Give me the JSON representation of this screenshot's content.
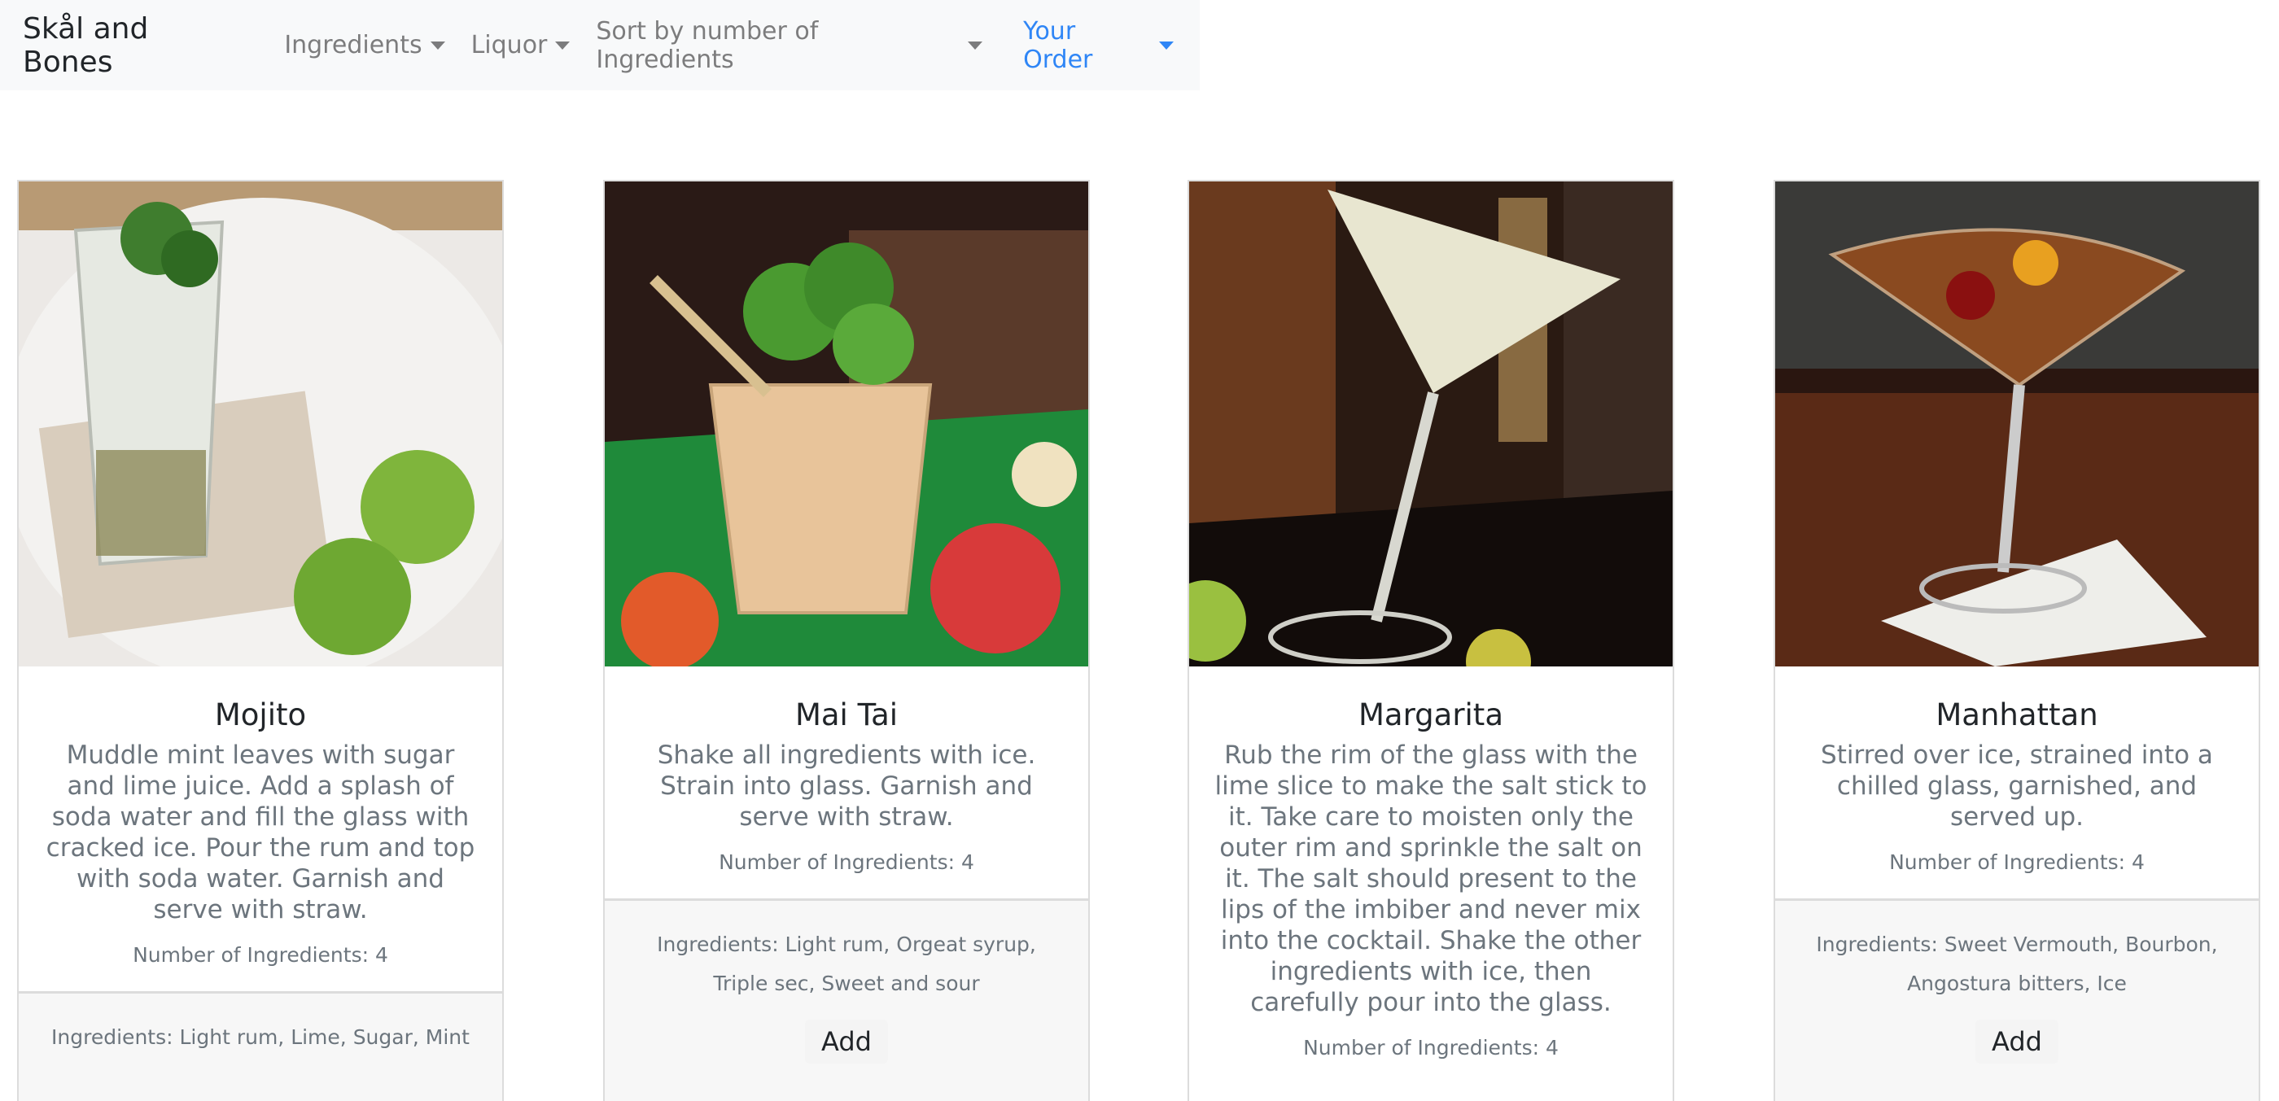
{
  "navbar": {
    "brand": "Skål and Bones",
    "items": [
      {
        "label": "Ingredients"
      },
      {
        "label": "Liquor"
      },
      {
        "label": "Sort by number of Ingredients"
      },
      {
        "label": "Your Order"
      }
    ],
    "active_color": "#2f86f6"
  },
  "cards": [
    {
      "title": "Mojito",
      "description": "Muddle mint leaves with sugar and lime juice. Add a splash of soda water and fill the glass with cracked ice. Pour the rum and top with soda water. Garnish and serve with straw.",
      "count": "Number of Ingredients: 4",
      "ingredients": "Ingredients: Light rum, Lime, Sugar, Mint",
      "add": ""
    },
    {
      "title": "Mai Tai",
      "description": "Shake all ingredients with ice. Strain into glass. Garnish and serve with straw.",
      "count": "Number of Ingredients: 4",
      "ingredients": "Ingredients: Light rum, Orgeat syrup, Triple sec, Sweet and sour",
      "add": "Add"
    },
    {
      "title": "Margarita",
      "description": "Rub the rim of the glass with the lime slice to make the salt stick to it. Take care to moisten only the outer rim and sprinkle the salt on it. The salt should present to the lips of the imbiber and never mix into the cocktail. Shake the other ingredients with ice, then carefully pour into the glass.",
      "count": "Number of Ingredients: 4",
      "ingredients": "",
      "add": ""
    },
    {
      "title": "Manhattan",
      "description": "Stirred over ice, strained into a chilled glass, garnished, and served up.",
      "count": "Number of Ingredients: 4",
      "ingredients": "Ingredients: Sweet Vermouth, Bourbon, Angostura bitters, Ice",
      "add": "Add"
    }
  ]
}
